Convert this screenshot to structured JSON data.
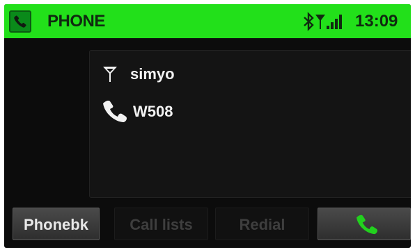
{
  "header": {
    "title": "PHONE",
    "time": "13:09",
    "app_icon": "phone-handset-icon",
    "status_icons": [
      "bluetooth-icon",
      "antenna-icon",
      "signal-strength-icon"
    ],
    "accent_color": "#22e01a"
  },
  "connection": {
    "network": {
      "icon": "antenna-icon",
      "name": "simyo"
    },
    "device": {
      "icon": "phone-handset-icon",
      "name": "W508"
    }
  },
  "buttons": [
    {
      "label": "Phonebk",
      "enabled": true
    },
    {
      "label": "Call lists",
      "enabled": false
    },
    {
      "label": "Redial",
      "enabled": false
    },
    {
      "label": "",
      "icon": "call-handset-icon",
      "icon_color": "#22d01e",
      "enabled": true
    }
  ]
}
